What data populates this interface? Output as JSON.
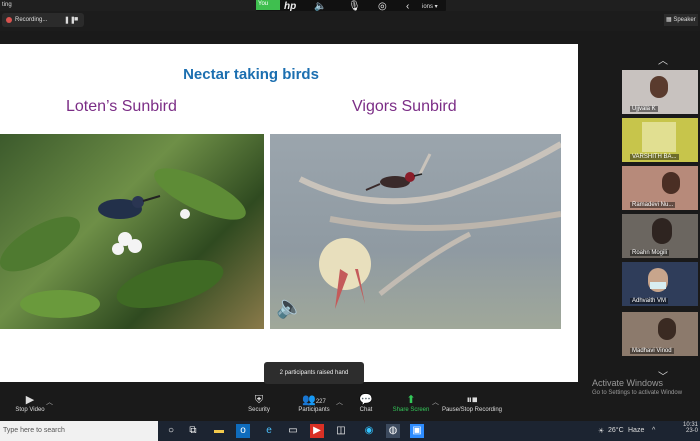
{
  "window": {
    "app_title": "ting"
  },
  "hp_toolbar": {
    "you_label": "You",
    "options_label": "ions ▾",
    "logo": "hp"
  },
  "recording": {
    "label": "Recording...",
    "pause_icon": "pause-icon",
    "stop_icon": "stop-icon"
  },
  "view": {
    "speaker_view_label": "Speaker"
  },
  "slide": {
    "title": "Nectar taking birds",
    "left_caption": "Loten’s Sunbird",
    "right_caption": "Vigors Sunbird"
  },
  "participants_tiles": [
    {
      "name": "Ujjvala K"
    },
    {
      "name": "VARSHITH BA..."
    },
    {
      "name": "Ramadevi Nu..."
    },
    {
      "name": "Roahn Mogili"
    },
    {
      "name": "Adhvaith VM"
    },
    {
      "name": "Madhavi Vinod"
    }
  ],
  "toolbar": {
    "stop_video": "Stop Video",
    "security": "Security",
    "participants": "Participants",
    "participants_count": "227",
    "chat": "Chat",
    "share_screen": "Share Screen",
    "pause_stop_recording": "Pause/Stop Recording"
  },
  "popup": {
    "raised_hand": "2 participants raised hand"
  },
  "activation": {
    "title": "Activate Windows",
    "subtitle": "Go to Settings to activate Window"
  },
  "taskbar": {
    "search_placeholder": "Type here to search",
    "weather": "26°C",
    "weather_text": "Haze",
    "time": "10:31",
    "date": "23-0"
  },
  "colors": {
    "accent_green": "#3fbf4f",
    "share_green": "#34c759",
    "title_blue": "#1c6fb0",
    "caption_purple": "#7b2d86"
  }
}
